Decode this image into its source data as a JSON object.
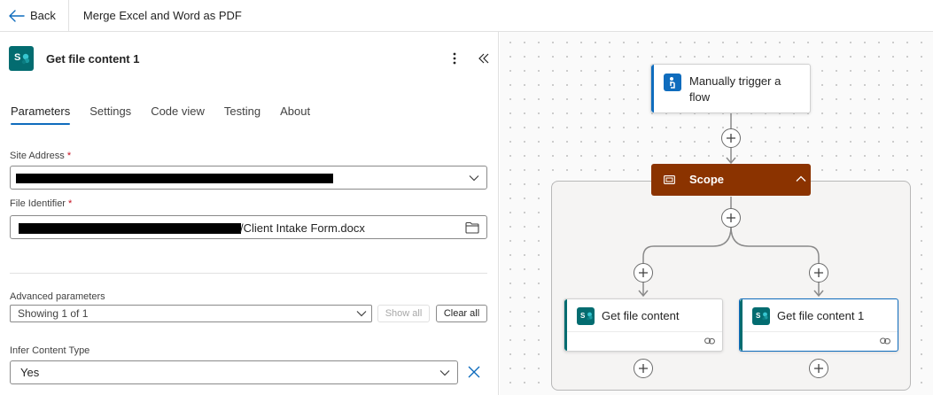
{
  "topbar": {
    "back_label": "Back",
    "flow_title": "Merge Excel and Word as PDF"
  },
  "panel": {
    "title": "Get file content 1",
    "tabs": [
      {
        "label": "Parameters",
        "active": true
      },
      {
        "label": "Settings",
        "active": false
      },
      {
        "label": "Code view",
        "active": false
      },
      {
        "label": "Testing",
        "active": false
      },
      {
        "label": "About",
        "active": false
      }
    ],
    "site_address": {
      "label": "Site Address",
      "required": "*"
    },
    "file_identifier": {
      "label": "File Identifier",
      "required": "*",
      "value_suffix": "/Client Intake Form.docx"
    },
    "advanced": {
      "label": "Advanced parameters",
      "selected": "Showing 1 of 1",
      "show_all_label": "Show all",
      "clear_all_label": "Clear all"
    },
    "infer_content_type": {
      "label": "Infer Content Type",
      "value": "Yes"
    }
  },
  "canvas": {
    "trigger": {
      "title_line1": "Manually trigger a",
      "title_line2": "flow"
    },
    "scope": {
      "label": "Scope"
    },
    "branch_left": {
      "title": "Get file content"
    },
    "branch_right": {
      "title": "Get file content 1"
    }
  },
  "colors": {
    "accent": "#0f6cbd",
    "scope": "#8b3300",
    "sharepoint": "#036c70"
  }
}
